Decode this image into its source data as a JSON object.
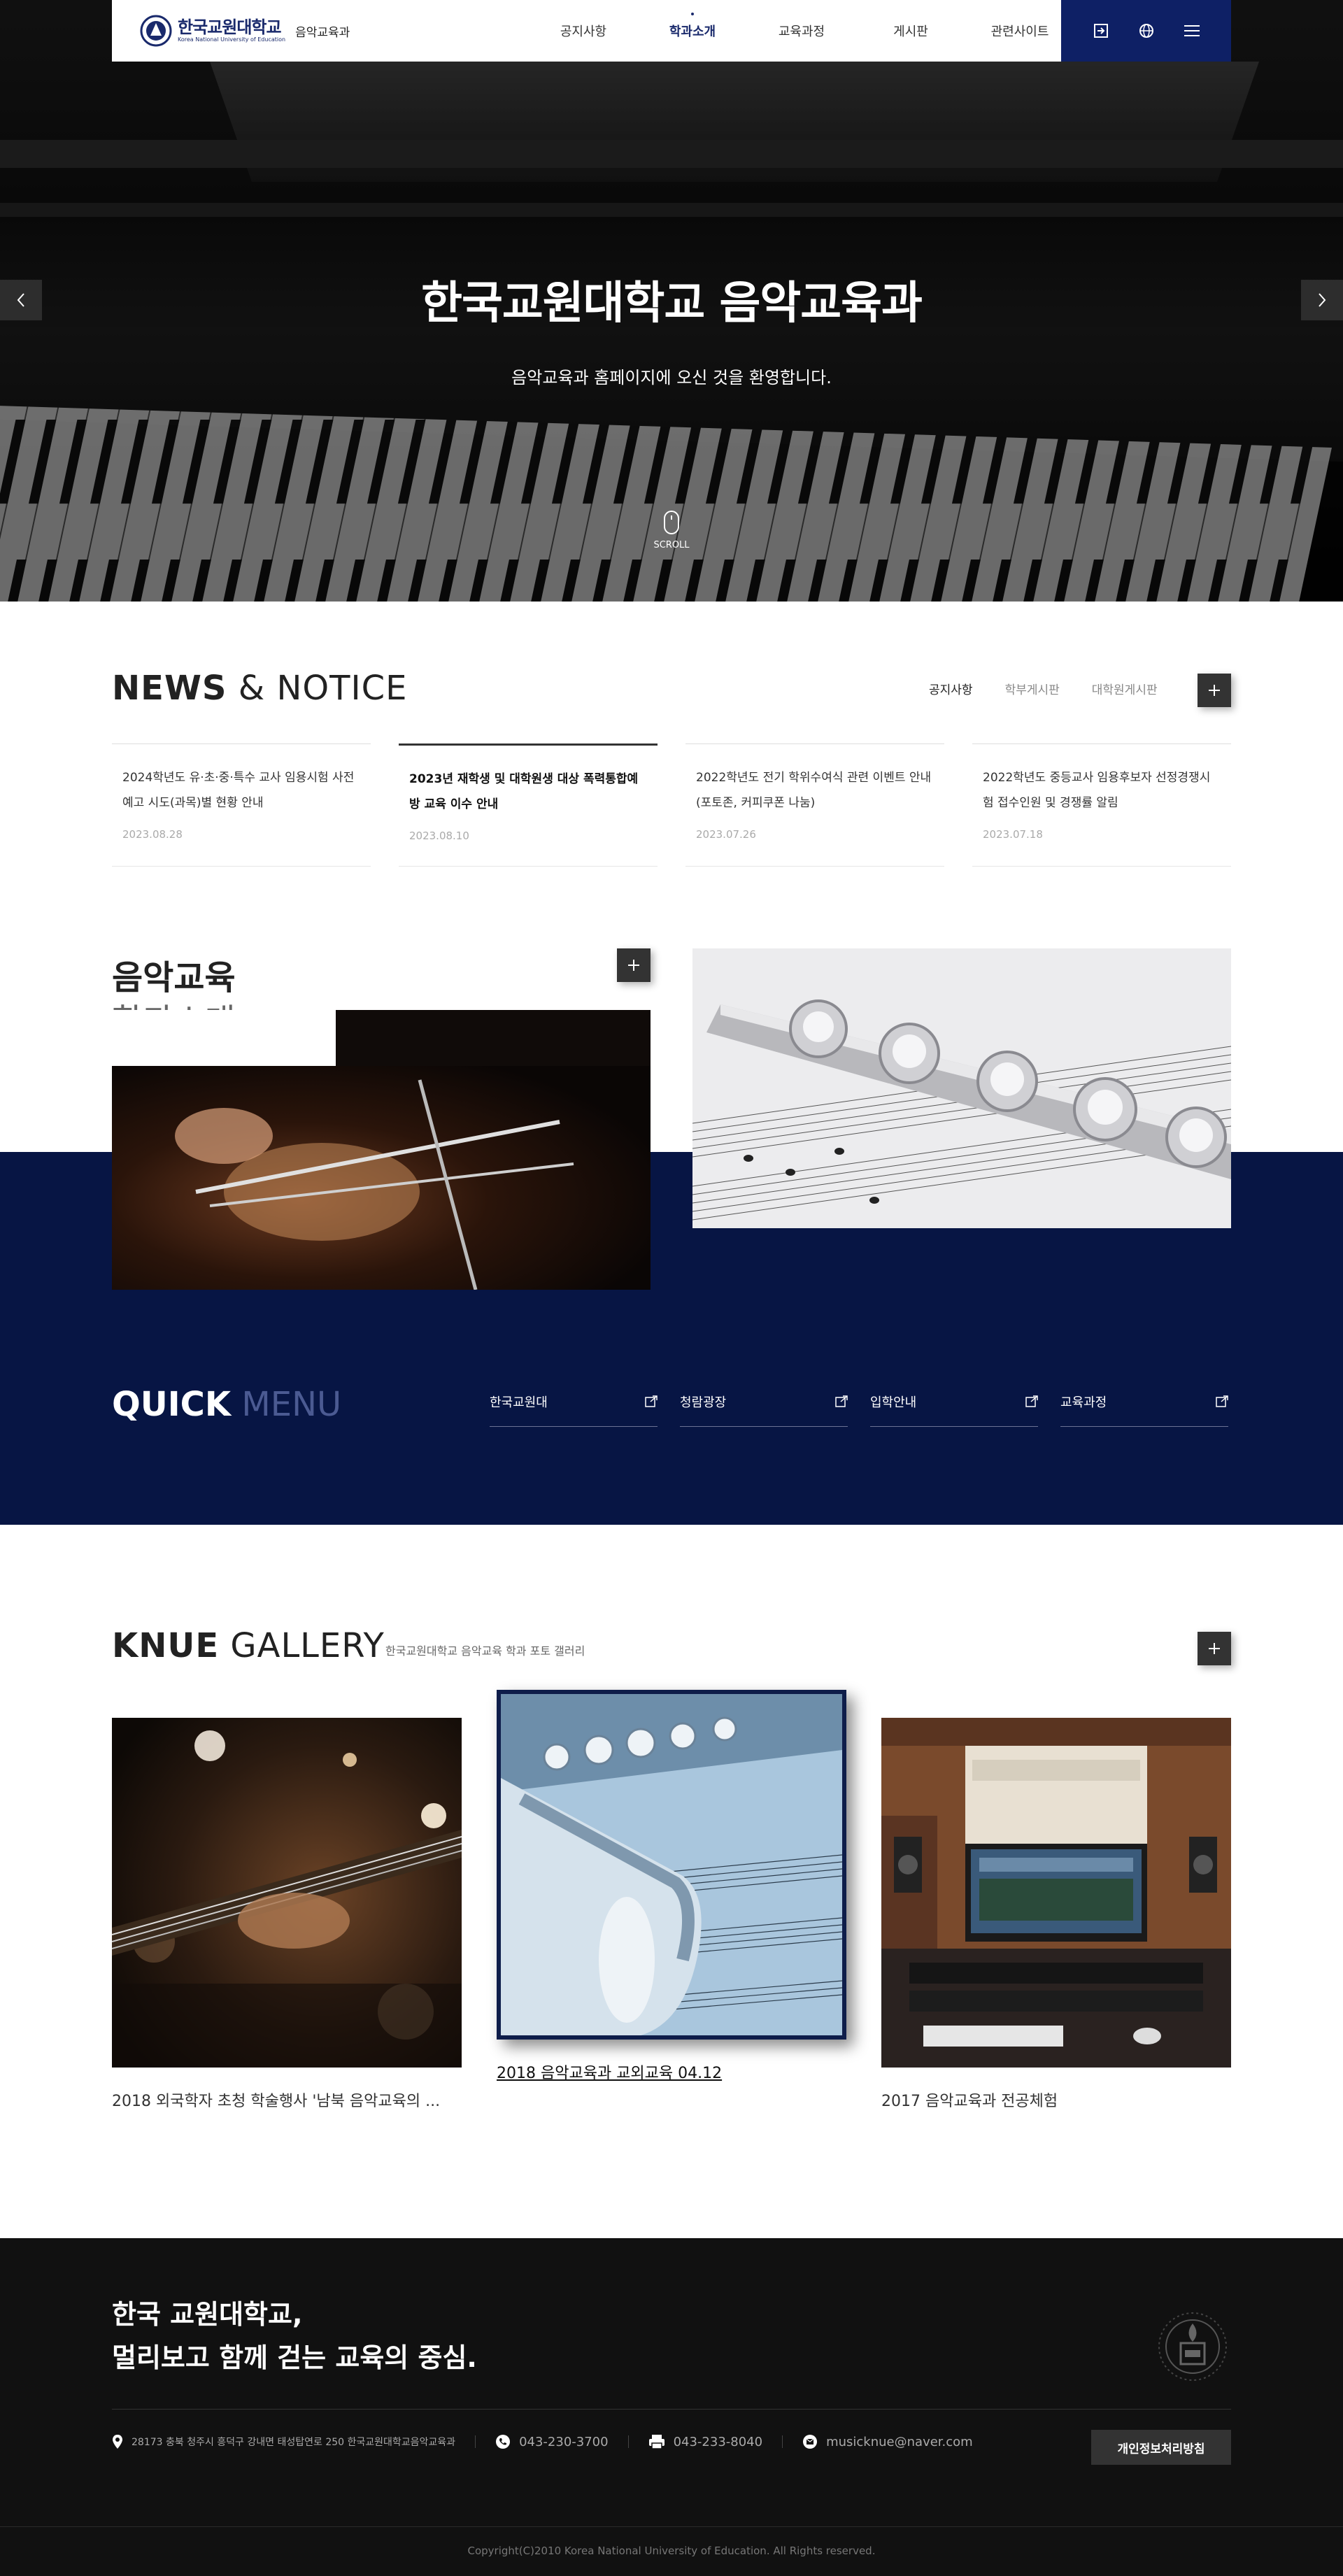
{
  "header": {
    "logo_text": "한국교원대학교",
    "logo_en": "Korea National University of Education",
    "dept": "음악교육과",
    "nav": [
      {
        "label": "공지사항",
        "active": false
      },
      {
        "label": "학과소개",
        "active": true
      },
      {
        "label": "교육과정",
        "active": false
      },
      {
        "label": "게시판",
        "active": false
      },
      {
        "label": "관련사이트",
        "active": false
      }
    ],
    "util_icons": [
      "login-icon",
      "globe-icon",
      "menu-icon"
    ]
  },
  "hero": {
    "title": "한국교원대학교 음악교육과",
    "subtitle": "음악교육과 홈페이지에 오신 것을 환영합니다.",
    "scroll_label": "SCROLL"
  },
  "news": {
    "title_bold": "NEWS",
    "title_light": "& NOTICE",
    "tabs": [
      {
        "label": "공지사항",
        "active": true
      },
      {
        "label": "학부게시판",
        "active": false
      },
      {
        "label": "대학원게시판",
        "active": false
      }
    ],
    "items": [
      {
        "text": "2024학년도 유·초·중·특수 교사 임용시험 사전예고 시도(과목)별 현황 안내",
        "date": "2023.08.28",
        "active": false
      },
      {
        "text": "2023년 재학생 및 대학원생 대상 폭력통합예방 교육 이수 안내",
        "date": "2023.08.10",
        "active": true
      },
      {
        "text": "2022학년도 전기 학위수여식 관련 이벤트 안내 (포토존, 커피쿠폰 나눔)",
        "date": "2023.07.26",
        "active": false
      },
      {
        "text": "2022학년도 중등교사 임용후보자 선정경쟁시험 접수인원 및 경쟁률 알림",
        "date": "2023.07.18",
        "active": false
      }
    ]
  },
  "about": {
    "title1": "음악교육",
    "title2": "학과소개"
  },
  "quick": {
    "title_bold": "QUICK",
    "title_light": "MENU",
    "items": [
      {
        "label": "한국교원대"
      },
      {
        "label": "청람광장"
      },
      {
        "label": "입학안내"
      },
      {
        "label": "교육과정"
      }
    ]
  },
  "gallery": {
    "title_bold": "KNUE",
    "title_light": "GALLERY",
    "subtitle": "한국교원대학교 음악교육 학과 포토 갤러리",
    "items": [
      {
        "caption": "2018 외국학자 초청 학술행사 '남북 음악교육의 ..."
      },
      {
        "caption": "2018 음악교육과 교외교육 04.12"
      },
      {
        "caption": "2017 음악교육과 전공체험"
      }
    ]
  },
  "footer": {
    "slogan_line1": "한국 교원대학교,",
    "slogan_line2": "멀리보고 함께 걷는 교육의 중심.",
    "address": "28173 충북 청주시 흥덕구 강내면 태성탑연로 250 한국교원대학교음악교육과",
    "phone": "043-230-3700",
    "fax": "043-233-8040",
    "email": "musicknue@naver.com",
    "privacy": "개인정보처리방침",
    "copyright": "Copyright(C)2010 Korea National University of Education. All Rights reserved."
  },
  "colors": {
    "navy": "#0e2065",
    "navy_dark": "#071544",
    "footer": "#111111"
  }
}
